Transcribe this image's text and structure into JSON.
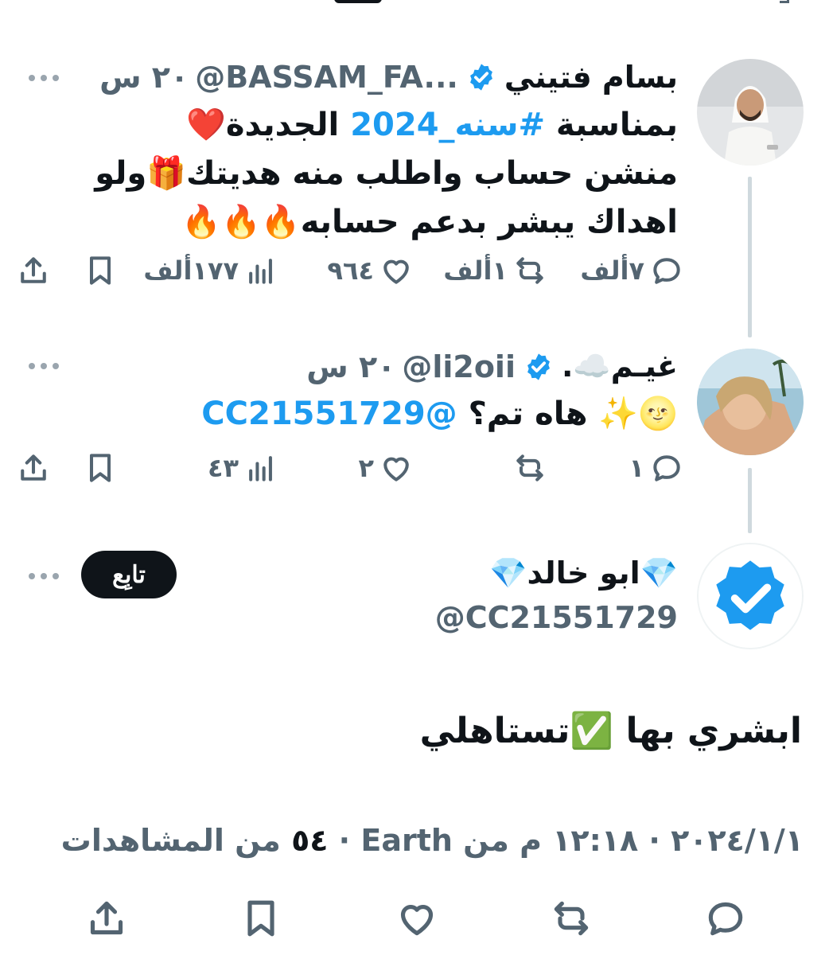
{
  "tweet1": {
    "display_name": "بسام فتيني",
    "handle": "@BASSAM_FA...",
    "time": "٢٠ س",
    "line1_prefix": "بمناسبة ",
    "line1_hashtag": "#سنه_2024",
    "line1_suffix": " الجديدة❤️",
    "line2": "منشن حساب واطلب منه هديتك🎁ولو",
    "line3": "اهداك يبشر بدعم حسابه🔥🔥🔥",
    "replies": "٧ألف",
    "reposts": "١ألف",
    "likes": "٩٦٤",
    "views": "١٧٧ألف",
    "avatar_icon": "avatar-photo-man"
  },
  "tweet2": {
    "display_name": "غيـم☁️.",
    "handle": "@li2oii",
    "time": "٢٠ س",
    "text_prefix": "🌝✨ هاه تم؟ ",
    "mention": "@CC21551729",
    "replies": "١",
    "reposts": "",
    "likes": "٢",
    "views": "٤٣",
    "avatar_icon": "avatar-photo-woman"
  },
  "main_tweet": {
    "display_name": "💎ابو خالد💎",
    "handle": "@CC21551729",
    "follow_label": "تابِع",
    "text": "ابشري بها ✅تستاهلي",
    "timestamp": "١٢:١٨ م من Earth",
    "date": "٢٠٢٤/١/١",
    "views_count": "٥٤",
    "views_label": "من المشاهدات",
    "avatar_icon": "avatar-verified-badge"
  },
  "colors": {
    "accent": "#1d9bf0",
    "text": "#0f1419",
    "muted": "#536471",
    "thread_line": "#cfd9de"
  }
}
